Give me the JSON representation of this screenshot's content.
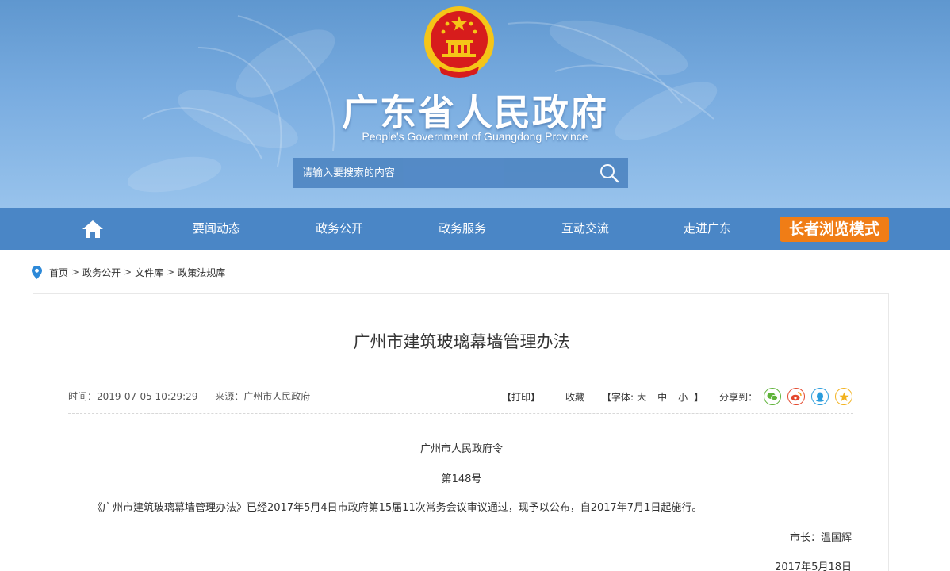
{
  "header": {
    "site_title": "广东省人民政府",
    "site_subtitle": "People's Government of Guangdong Province",
    "search_placeholder": "请输入要搜索的内容",
    "colors": {
      "banner_top": "#5f97cf",
      "banner_bottom": "#98c3ec",
      "emblem_red": "#d71c1c",
      "emblem_gold": "#f5c518"
    }
  },
  "nav": {
    "items": [
      "要闻动态",
      "政务公开",
      "政务服务",
      "互动交流",
      "走进广东"
    ],
    "elder_mode": "长者浏览模式",
    "colors": {
      "bar": "#4a86c6",
      "elder_button": "#f07d16"
    }
  },
  "breadcrumb": {
    "items": [
      "首页",
      "政务公开",
      "文件库",
      "政策法规库"
    ],
    "separator": ">"
  },
  "article": {
    "title": "广州市建筑玻璃幕墙管理办法",
    "meta": {
      "time": "时间：2019-07-05 10:29:29",
      "source": "来源：广州市人民政府"
    },
    "tools": {
      "print": "【打印】",
      "favorite": "收藏",
      "font_prefix": "【字体:",
      "font_large": "大",
      "font_medium": "中",
      "font_small": "小",
      "font_suffix": "】",
      "share_label": "分享到："
    },
    "share_icons": [
      {
        "name": "wechat-icon",
        "color": "#5fb33a"
      },
      {
        "name": "weibo-icon",
        "color": "#e4482d"
      },
      {
        "name": "qq-icon",
        "color": "#2a9cdc"
      },
      {
        "name": "qzone-icon",
        "color": "#f2b21f"
      }
    ],
    "body": {
      "issuer": "广州市人民政府令",
      "number": "第148号",
      "paragraph": "《广州市建筑玻璃幕墙管理办法》已经2017年5月4日市政府第15届11次常务会议审议通过，现予以公布，自2017年7月1日起施行。",
      "signature": "市长：温国辉",
      "date": "2017年5月18日"
    }
  }
}
